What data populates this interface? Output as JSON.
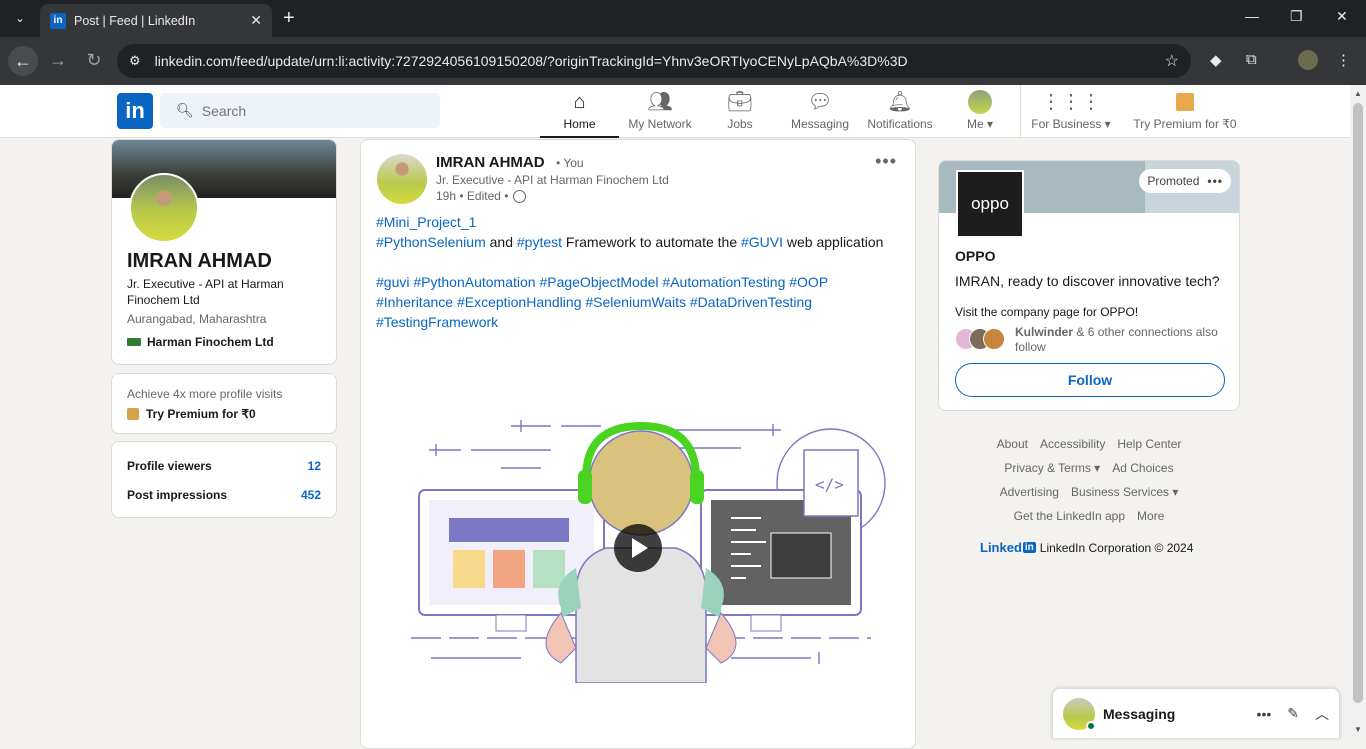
{
  "browser": {
    "tab_title": "Post | Feed | LinkedIn",
    "tab_favicon": "in",
    "url": "linkedin.com/feed/update/urn:li:activity:7272924056109150208/?originTrackingId=Yhnv3eORTIyoCENyLpAQbA%3D%3D"
  },
  "header": {
    "logo": "in",
    "search_placeholder": "Search",
    "nav": [
      {
        "label": "Home",
        "icon": "home-icon"
      },
      {
        "label": "My Network",
        "icon": "network-icon"
      },
      {
        "label": "Jobs",
        "icon": "jobs-icon"
      },
      {
        "label": "Messaging",
        "icon": "messaging-icon"
      },
      {
        "label": "Notifications",
        "icon": "bell-icon"
      },
      {
        "label": "Me",
        "icon": "avatar"
      }
    ],
    "business": "For Business",
    "premium": "Try Premium for ₹0"
  },
  "profile": {
    "name": "IMRAN AHMAD",
    "headline": "Jr. Executive - API at Harman Finochem Ltd",
    "location": "Aurangabad, Maharashtra",
    "company": "Harman Finochem Ltd",
    "premium_pitch": "Achieve 4x more profile visits",
    "premium_cta": "Try Premium for ₹0",
    "stats": [
      {
        "label": "Profile viewers",
        "value": "12"
      },
      {
        "label": "Post impressions",
        "value": "452"
      }
    ]
  },
  "post": {
    "author": "IMRAN AHMAD",
    "author_badge": "• You",
    "headline": "Jr. Executive - API at Harman Finochem Ltd",
    "meta": "19h • Edited •",
    "line1": "#Mini_Project_1",
    "line2_tag1": "#PythonSelenium",
    "line2_and": " and ",
    "line2_tag2": "#pytest",
    "line2_mid": " Framework to automate the ",
    "line2_tag3": "#GUVI",
    "line2_end": " web application",
    "tags_line3": "#guvi #PythonAutomation #PageObjectModel #AutomationTesting #OOP",
    "tags_line4": "#Inheritance #ExceptionHandling #SeleniumWaits #DataDrivenTesting",
    "tags_line5": "#TestingFramework"
  },
  "ad": {
    "promoted": "Promoted",
    "logo_text": "oppo",
    "company": "OPPO",
    "tagline": "IMRAN, ready to discover innovative tech?",
    "sub": "Visit the company page for OPPO!",
    "conn_name": "Kulwinder",
    "conn_rest": " & 6 other connections also follow",
    "follow": "Follow"
  },
  "footer": {
    "row1": [
      "About",
      "Accessibility",
      "Help Center"
    ],
    "row2": [
      "Privacy & Terms ▾",
      "Ad Choices"
    ],
    "row3": [
      "Advertising",
      "Business Services ▾"
    ],
    "row4": [
      "Get the LinkedIn app",
      "More"
    ],
    "brand": "Linked",
    "copy": "LinkedIn Corporation © 2024"
  },
  "messaging": {
    "label": "Messaging"
  },
  "colors": {
    "brand": "#0a66c2",
    "background": "#f4f2ee"
  }
}
